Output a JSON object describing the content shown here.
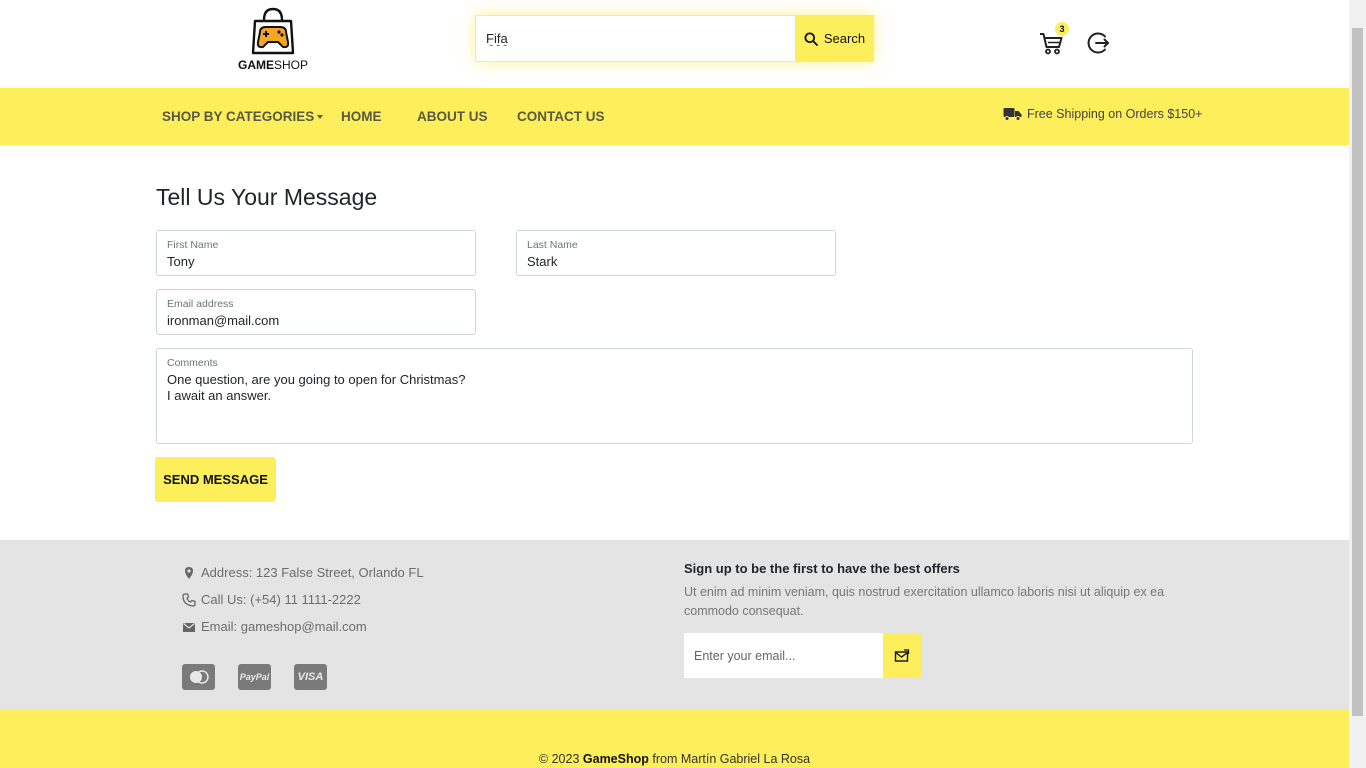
{
  "header": {
    "logo_bold": "GAME",
    "logo_light": "SHOP",
    "search_value": "Fifa",
    "search_button": "Search",
    "cart_count": "3"
  },
  "nav": {
    "items": [
      {
        "label": "SHOP BY CATEGORIES"
      },
      {
        "label": "HOME"
      },
      {
        "label": "ABOUT US"
      },
      {
        "label": "CONTACT US"
      }
    ],
    "shipping": "Free Shipping on Orders $150+"
  },
  "form": {
    "title": "Tell Us Your Message",
    "first_name_label": "First Name",
    "first_name_value": "Tony",
    "last_name_label": "Last Name",
    "last_name_value": "Stark",
    "email_label": "Email address",
    "email_value": "ironman@mail.com",
    "comments_label": "Comments",
    "comments_line1": "One question, are you going to open for Christmas?",
    "comments_line2": "I await an answer.",
    "send_button": "SEND MESSAGE"
  },
  "footer": {
    "address": "Address: 123 False Street, Orlando FL",
    "phone": "Call Us: (+54) 11 1111-2222",
    "email": "Email: gameshop@mail.com",
    "payment_methods": [
      "Mastercard",
      "PayPal",
      "VISA"
    ],
    "signup_title": "Sign up to be the first to have the best offers",
    "signup_text": "Ut enim ad minim veniam, quis nostrud exercitation ullamco laboris nisi ut aliquip ex ea commodo consequat.",
    "newsletter_placeholder": "Enter your email...",
    "copyright_prefix": "© 2023",
    "copyright_brand": "GameShop",
    "copyright_suffix": "from Martín Gabriel La Rosa"
  },
  "colors": {
    "accent_yellow": "#fdee5c",
    "footer_gray": "#e4e4e4"
  }
}
